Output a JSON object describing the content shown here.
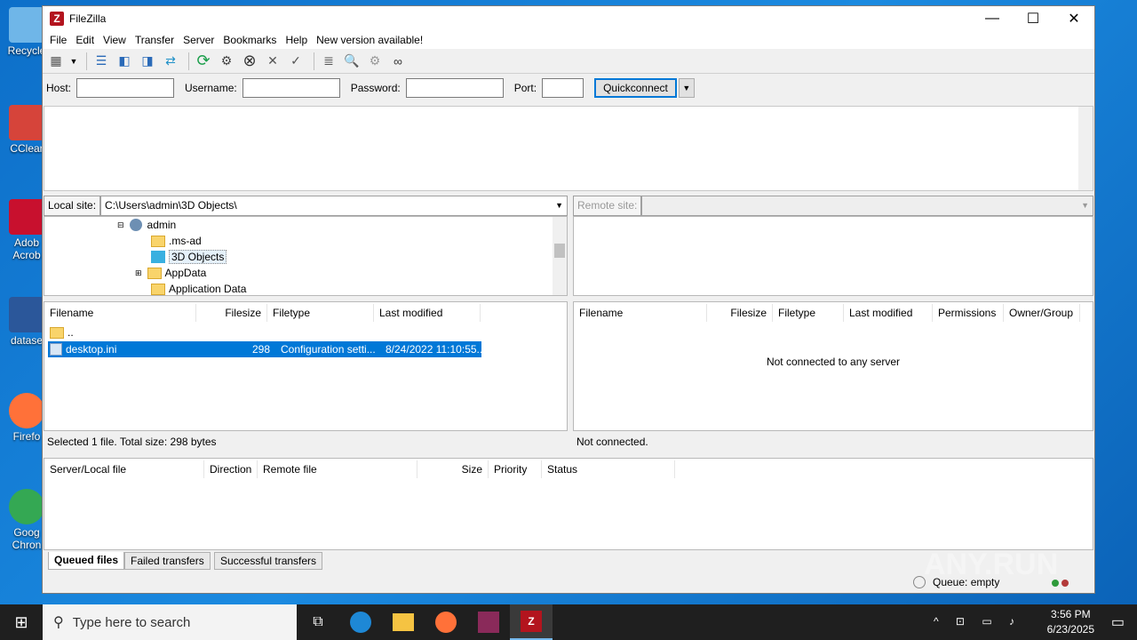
{
  "desktop": {
    "icons": [
      {
        "label": "Recycle",
        "color": "#6fb6e8"
      },
      {
        "label": "CClear",
        "color": "#d6443a"
      },
      {
        "label": "Adob Acrob",
        "color": "#c8102e"
      },
      {
        "label": "datase",
        "color": "#2b579a"
      },
      {
        "label": "Firefo",
        "color": "#ff7139"
      },
      {
        "label": "Goog Chron",
        "color": "#34a853"
      }
    ]
  },
  "window": {
    "title": "FileZilla",
    "minimize": "—",
    "maximize": "☐",
    "close": "✕"
  },
  "menu": [
    "File",
    "Edit",
    "View",
    "Transfer",
    "Server",
    "Bookmarks",
    "Help",
    "New version available!"
  ],
  "quickconnect": {
    "host_label": "Host:",
    "username_label": "Username:",
    "password_label": "Password:",
    "port_label": "Port:",
    "button": "Quickconnect",
    "host_value": "",
    "username_value": "",
    "password_value": "",
    "port_value": ""
  },
  "local": {
    "site_label": "Local site:",
    "path": "C:\\Users\\admin\\3D Objects\\",
    "tree": [
      {
        "label": "admin",
        "type": "user"
      },
      {
        "label": ".ms-ad",
        "type": "folder"
      },
      {
        "label": "3D Objects",
        "type": "3d",
        "selected": true
      },
      {
        "label": "AppData",
        "type": "folder"
      },
      {
        "label": "Application Data",
        "type": "folder"
      }
    ],
    "columns": [
      "Filename",
      "Filesize",
      "Filetype",
      "Last modified"
    ],
    "rows": [
      {
        "name": "..",
        "size": "",
        "type": "",
        "modified": ""
      },
      {
        "name": "desktop.ini",
        "size": "298",
        "type": "Configuration setti...",
        "modified": "8/24/2022 11:10:55..."
      }
    ],
    "status": "Selected 1 file. Total size: 298 bytes"
  },
  "remote": {
    "site_label": "Remote site:",
    "columns": [
      "Filename",
      "Filesize",
      "Filetype",
      "Last modified",
      "Permissions",
      "Owner/Group"
    ],
    "empty_message": "Not connected to any server",
    "status": "Not connected."
  },
  "queue": {
    "columns": [
      "Server/Local file",
      "Direction",
      "Remote file",
      "Size",
      "Priority",
      "Status"
    ],
    "tabs": [
      "Queued files",
      "Failed transfers",
      "Successful transfers"
    ],
    "status": "Queue: empty"
  },
  "taskbar": {
    "search_placeholder": "Type here to search",
    "time": "3:56 PM",
    "date": "6/23/2025"
  },
  "watermark": "ANY.RUN"
}
